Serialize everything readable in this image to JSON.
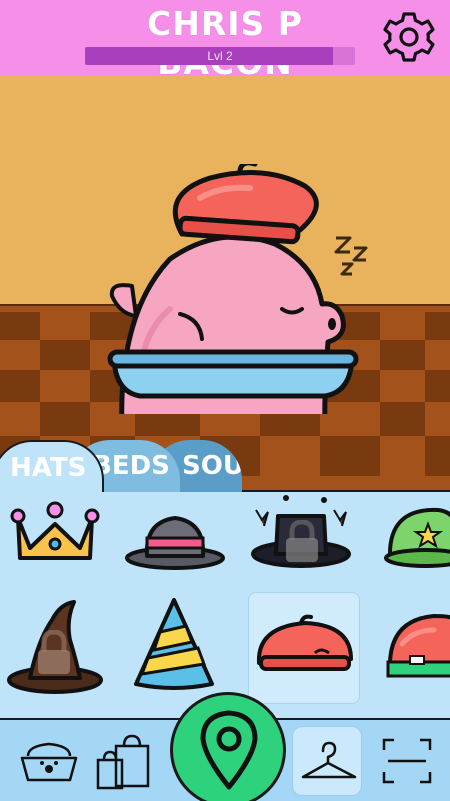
{
  "header": {
    "pet_name": "CHRIS P BACON",
    "level_label": "Lvl 2",
    "level_progress": 0.92,
    "settings_icon": "gear-icon"
  },
  "scene": {
    "sleep_text": "ZZZ"
  },
  "tabs": [
    {
      "label": "HATS",
      "active": true
    },
    {
      "label": "BEDS",
      "active": false
    },
    {
      "label": "SOUNDS",
      "active": false
    }
  ],
  "items": [
    {
      "name": "crown",
      "locked": false,
      "selected": false
    },
    {
      "name": "bowler-hat",
      "locked": false,
      "selected": false
    },
    {
      "name": "magic-top-hat",
      "locked": true,
      "selected": false
    },
    {
      "name": "green-star-hat",
      "locked": false,
      "selected": false
    },
    {
      "name": "witch-hat",
      "locked": true,
      "selected": false
    },
    {
      "name": "party-hat",
      "locked": false,
      "selected": false
    },
    {
      "name": "red-beret",
      "locked": false,
      "selected": true
    },
    {
      "name": "red-helmet",
      "locked": false,
      "selected": false
    }
  ],
  "nav": {
    "items": [
      "food-bowl-icon",
      "shopping-bag-icon",
      "map-pin-icon",
      "hanger-icon",
      "scan-icon"
    ],
    "active": "hanger-icon"
  },
  "colors": {
    "header": "#F58FE8",
    "wall": "#E8B35C",
    "floor_dark": "#7A3A10",
    "floor_light": "#A4521C",
    "panel": "#BFE4FA",
    "nav": "#A4D6F5",
    "map_button": "#2ED17C"
  }
}
